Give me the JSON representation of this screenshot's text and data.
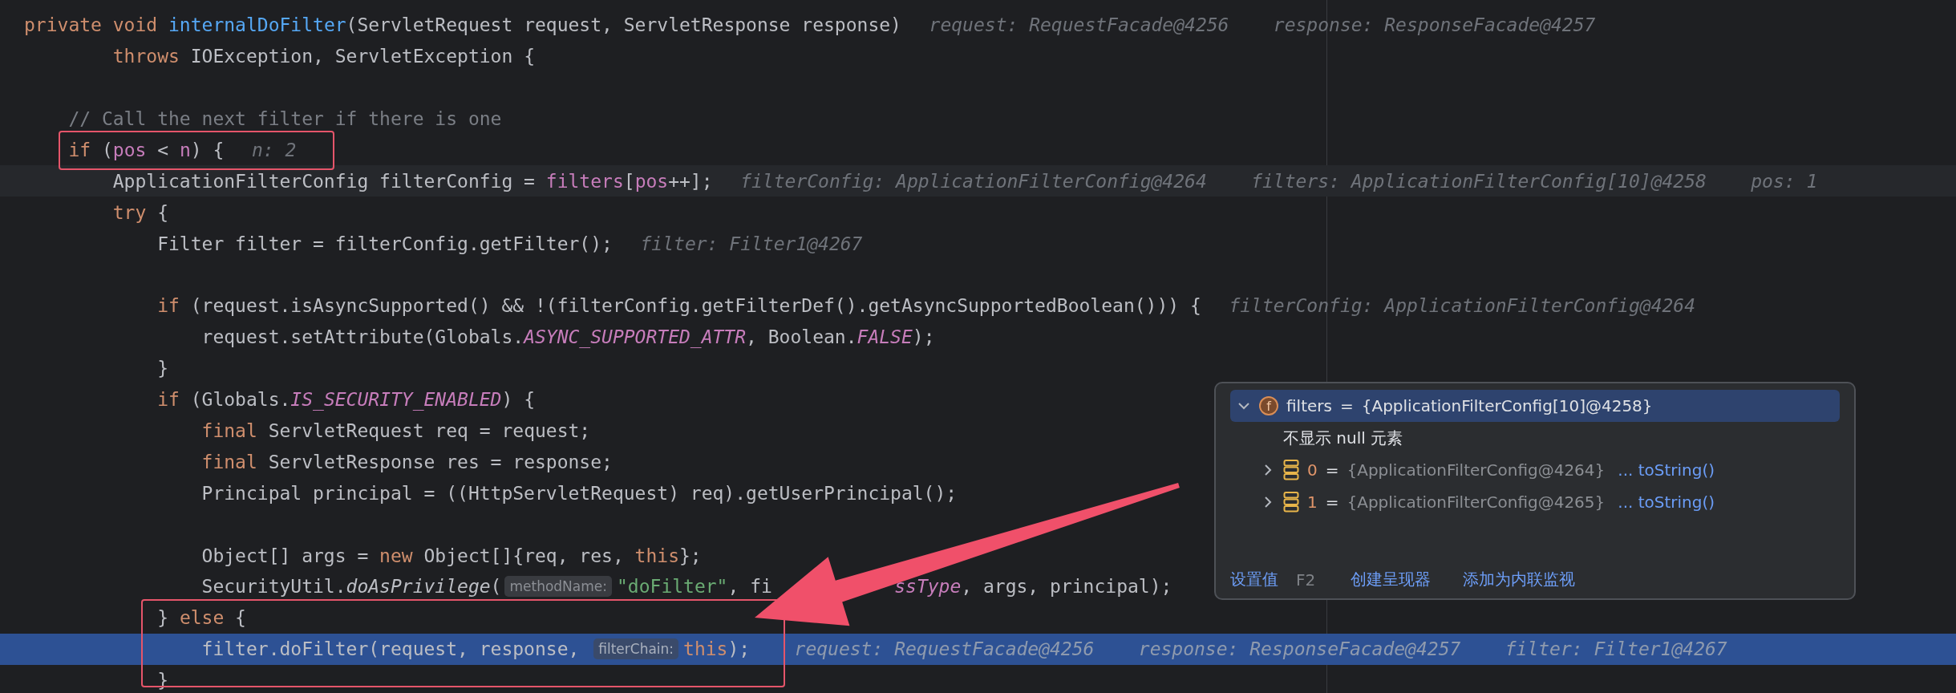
{
  "code": {
    "lines": [
      {
        "kind": "code",
        "tokens": [
          {
            "kind": "keyword",
            "text": "private void "
          },
          {
            "kind": "declaration",
            "text": "internalDoFilter"
          },
          {
            "kind": "plain",
            "text": "(ServletRequest request, ServletResponse response)"
          }
        ],
        "inline_values": [
          "request: RequestFacade@4256",
          "response: ResponseFacade@4257"
        ]
      },
      {
        "kind": "code",
        "tokens": [
          {
            "kind": "keyword",
            "text": "        throws"
          },
          {
            "kind": "plain",
            "text": " IOException, ServletException {"
          }
        ]
      },
      {
        "kind": "blank"
      },
      {
        "kind": "code",
        "tokens": [
          {
            "kind": "comment",
            "text": "    // Call the next filter if there is one"
          }
        ]
      },
      {
        "kind": "code",
        "tokens": [
          {
            "kind": "keyword",
            "text": "    if"
          },
          {
            "kind": "plain",
            "text": " ("
          },
          {
            "kind": "field",
            "text": "pos"
          },
          {
            "kind": "plain",
            "text": " < "
          },
          {
            "kind": "field",
            "text": "n"
          },
          {
            "kind": "plain",
            "text": ") {"
          }
        ],
        "inline_values": [
          "n: 2"
        ]
      },
      {
        "kind": "caret",
        "tokens": [
          {
            "kind": "plain",
            "text": "        ApplicationFilterConfig filterConfig = "
          },
          {
            "kind": "field",
            "text": "filters"
          },
          {
            "kind": "plain",
            "text": "["
          },
          {
            "kind": "field",
            "text": "pos"
          },
          {
            "kind": "plain",
            "text": "++];"
          }
        ],
        "inline_values": [
          "filterConfig: ApplicationFilterConfig@4264",
          "filters: ApplicationFilterConfig[10]@4258",
          "pos: 1"
        ]
      },
      {
        "kind": "code",
        "tokens": [
          {
            "kind": "keyword",
            "text": "        try"
          },
          {
            "kind": "plain",
            "text": " {"
          }
        ]
      },
      {
        "kind": "code",
        "tokens": [
          {
            "kind": "plain",
            "text": "            Filter filter = filterConfig.getFilter();"
          }
        ],
        "inline_values": [
          "filter: Filter1@4267"
        ]
      },
      {
        "kind": "blank"
      },
      {
        "kind": "code",
        "tokens": [
          {
            "kind": "keyword",
            "text": "            if"
          },
          {
            "kind": "plain",
            "text": " (request.isAsyncSupported() && !(filterConfig.getFilterDef().getAsyncSupportedBoolean())) {"
          }
        ],
        "inline_values": [
          "filterConfig: ApplicationFilterConfig@4264"
        ]
      },
      {
        "kind": "code",
        "tokens": [
          {
            "kind": "plain",
            "text": "                request.setAttribute(Globals."
          },
          {
            "kind": "static",
            "text": "ASYNC_SUPPORTED_ATTR"
          },
          {
            "kind": "plain",
            "text": ", Boolean."
          },
          {
            "kind": "static",
            "text": "FALSE"
          },
          {
            "kind": "plain",
            "text": ");"
          }
        ]
      },
      {
        "kind": "code",
        "tokens": [
          {
            "kind": "plain",
            "text": "            }"
          }
        ]
      },
      {
        "kind": "code",
        "tokens": [
          {
            "kind": "keyword",
            "text": "            if"
          },
          {
            "kind": "plain",
            "text": " (Globals."
          },
          {
            "kind": "static",
            "text": "IS_SECURITY_ENABLED"
          },
          {
            "kind": "plain",
            "text": ") {"
          }
        ]
      },
      {
        "kind": "code",
        "tokens": [
          {
            "kind": "keyword",
            "text": "                final"
          },
          {
            "kind": "plain",
            "text": " ServletRequest req = request;"
          }
        ]
      },
      {
        "kind": "code",
        "tokens": [
          {
            "kind": "keyword",
            "text": "                final"
          },
          {
            "kind": "plain",
            "text": " ServletResponse res = response;"
          }
        ]
      },
      {
        "kind": "code",
        "tokens": [
          {
            "kind": "plain",
            "text": "                Principal principal = ((HttpServletRequest) req).getUserPrincipal();"
          }
        ]
      },
      {
        "kind": "blank"
      },
      {
        "kind": "code",
        "tokens": [
          {
            "kind": "plain",
            "text": "                Object[] args = "
          },
          {
            "kind": "keyword",
            "text": "new"
          },
          {
            "kind": "plain",
            "text": " Object[]{req, res, "
          },
          {
            "kind": "keyword",
            "text": "this"
          },
          {
            "kind": "plain",
            "text": "};"
          }
        ]
      },
      {
        "kind": "code",
        "tokens": [
          {
            "kind": "plain",
            "text": "                SecurityUtil."
          },
          {
            "kind": "italic",
            "text": "doAsPrivilege"
          },
          {
            "kind": "plain",
            "text": "("
          },
          {
            "kind": "hint",
            "text": "methodName:"
          },
          {
            "kind": "string",
            "text": "\"doFilter\""
          },
          {
            "kind": "plain",
            "text": ", fi"
          },
          {
            "kind": "covered"
          },
          {
            "kind": "static",
            "text": "ssType"
          },
          {
            "kind": "plain",
            "text": ", args, principal);"
          }
        ]
      },
      {
        "kind": "code",
        "tokens": [
          {
            "kind": "plain",
            "text": "            } "
          },
          {
            "kind": "keyword",
            "text": "else"
          },
          {
            "kind": "plain",
            "text": " {"
          }
        ]
      },
      {
        "kind": "execution",
        "tokens": [
          {
            "kind": "plain",
            "text": "                filter.doFilter(request, response, "
          },
          {
            "kind": "hint",
            "text": "filterChain:"
          },
          {
            "kind": "keyword",
            "text": "this"
          },
          {
            "kind": "plain",
            "text": ");"
          }
        ],
        "inline_values": [
          "request: RequestFacade@4256",
          "response: ResponseFacade@4257",
          "filter: Filter1@4267"
        ]
      },
      {
        "kind": "code",
        "tokens": [
          {
            "kind": "plain",
            "text": "            }"
          }
        ]
      }
    ]
  },
  "popup": {
    "tree": [
      {
        "badge": "f",
        "name": "filters",
        "separator": "=",
        "value": "{ApplicationFilterConfig[10]@4258}",
        "expanded": true,
        "selected": true,
        "children": [
          {
            "kind": "note",
            "text": "不显示 null 元素"
          },
          {
            "kind": "entry",
            "index": "0",
            "separator": "=",
            "value": "{ApplicationFilterConfig@4264}",
            "link": "... toString()",
            "expanded": false,
            "selected": false
          },
          {
            "kind": "entry",
            "index": "1",
            "separator": "=",
            "value": "{ApplicationFilterConfig@4265}",
            "link": "... toString()",
            "expanded": false,
            "selected": false
          }
        ]
      }
    ],
    "actions": [
      {
        "label": "设置值",
        "shortcut": "F2"
      },
      {
        "label": "创建呈现器"
      },
      {
        "label": "添加为内联监视"
      }
    ]
  }
}
